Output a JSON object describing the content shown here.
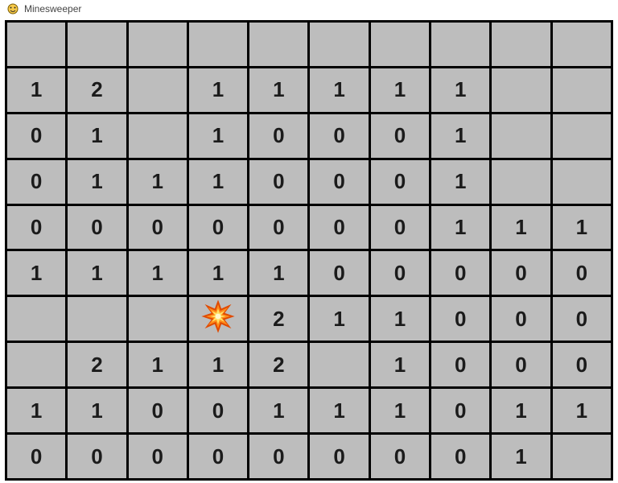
{
  "window": {
    "title": "Minesweeper",
    "icon": "minesweeper-icon"
  },
  "board": {
    "cols": 10,
    "rows": 10,
    "grid": [
      [
        "",
        "",
        "",
        "",
        "",
        "",
        "",
        "",
        "",
        ""
      ],
      [
        "1",
        "2",
        "",
        "1",
        "1",
        "1",
        "1",
        "1",
        "",
        ""
      ],
      [
        "0",
        "1",
        "",
        "1",
        "0",
        "0",
        "0",
        "1",
        "",
        ""
      ],
      [
        "0",
        "1",
        "1",
        "1",
        "0",
        "0",
        "0",
        "1",
        "",
        ""
      ],
      [
        "0",
        "0",
        "0",
        "0",
        "0",
        "0",
        "0",
        "1",
        "1",
        "1"
      ],
      [
        "1",
        "1",
        "1",
        "1",
        "1",
        "0",
        "0",
        "0",
        "0",
        "0"
      ],
      [
        "",
        "",
        "",
        "*",
        "2",
        "1",
        "1",
        "0",
        "0",
        "0"
      ],
      [
        "",
        "2",
        "1",
        "1",
        "2",
        "",
        "1",
        "0",
        "0",
        "0"
      ],
      [
        "1",
        "1",
        "0",
        "0",
        "1",
        "1",
        "1",
        "0",
        "1",
        "1"
      ],
      [
        "0",
        "0",
        "0",
        "0",
        "0",
        "0",
        "0",
        "0",
        "1",
        ""
      ]
    ],
    "legend": {
      "*": "explosion"
    }
  }
}
